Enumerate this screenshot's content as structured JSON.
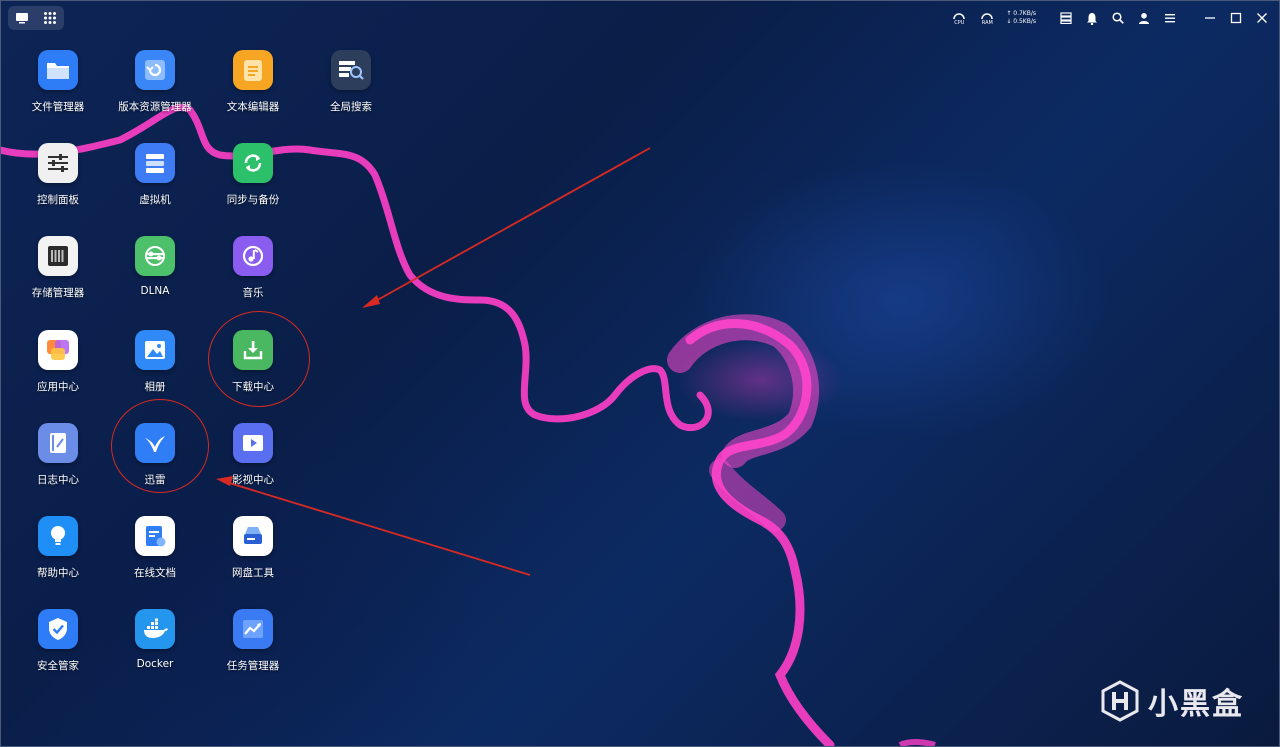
{
  "topbar": {
    "cpu_label": "CPU",
    "ram_label": "RAM",
    "net_up": "0.7KB/s",
    "net_down": "0.5KB/s"
  },
  "apps": [
    {
      "label": "文件管理器",
      "icon": "folder-icon",
      "color": "#2f7df6"
    },
    {
      "label": "版本资源管理器",
      "icon": "version-history-icon",
      "color": "#3b86f7"
    },
    {
      "label": "文本编辑器",
      "icon": "document-edit-icon",
      "color": "#f6a623"
    },
    {
      "label": "全局搜索",
      "icon": "global-search-icon",
      "color": "#2c3e5c"
    },
    {
      "label": "控制面板",
      "icon": "sliders-icon",
      "color": "#f0f0f0"
    },
    {
      "label": "虚拟机",
      "icon": "server-icon",
      "color": "#3e7cf5"
    },
    {
      "label": "同步与备份",
      "icon": "sync-icon",
      "color": "#2cc06a"
    },
    {
      "label": "存储管理器",
      "icon": "storage-icon",
      "color": "#f3f3f3"
    },
    {
      "label": "DLNA",
      "icon": "dlna-icon",
      "color": "#4cc06a"
    },
    {
      "label": "音乐",
      "icon": "music-icon",
      "color": "#8a5cf0"
    },
    {
      "label": "应用中心",
      "icon": "app-center-icon",
      "color": "#ffffff"
    },
    {
      "label": "相册",
      "icon": "photo-album-icon",
      "color": "#2f8af7"
    },
    {
      "label": "下载中心",
      "icon": "download-icon",
      "color": "#49b860"
    },
    {
      "label": "日志中心",
      "icon": "log-icon",
      "color": "#6b8de8"
    },
    {
      "label": "迅雷",
      "icon": "thunder-bird-icon",
      "color": "#2f7ef5"
    },
    {
      "label": "影视中心",
      "icon": "video-icon",
      "color": "#5a6ff0"
    },
    {
      "label": "帮助中心",
      "icon": "lightbulb-icon",
      "color": "#1f8ef5"
    },
    {
      "label": "在线文档",
      "icon": "online-doc-icon",
      "color": "#ffffff"
    },
    {
      "label": "网盘工具",
      "icon": "cloud-drive-icon",
      "color": "#ffffff"
    },
    {
      "label": "安全管家",
      "icon": "shield-check-icon",
      "color": "#2f7df6"
    },
    {
      "label": "Docker",
      "icon": "docker-icon",
      "color": "#2496ed"
    },
    {
      "label": "任务管理器",
      "icon": "task-manager-icon",
      "color": "#3a7bf3"
    }
  ],
  "watermark": {
    "text": "小黑盒"
  }
}
